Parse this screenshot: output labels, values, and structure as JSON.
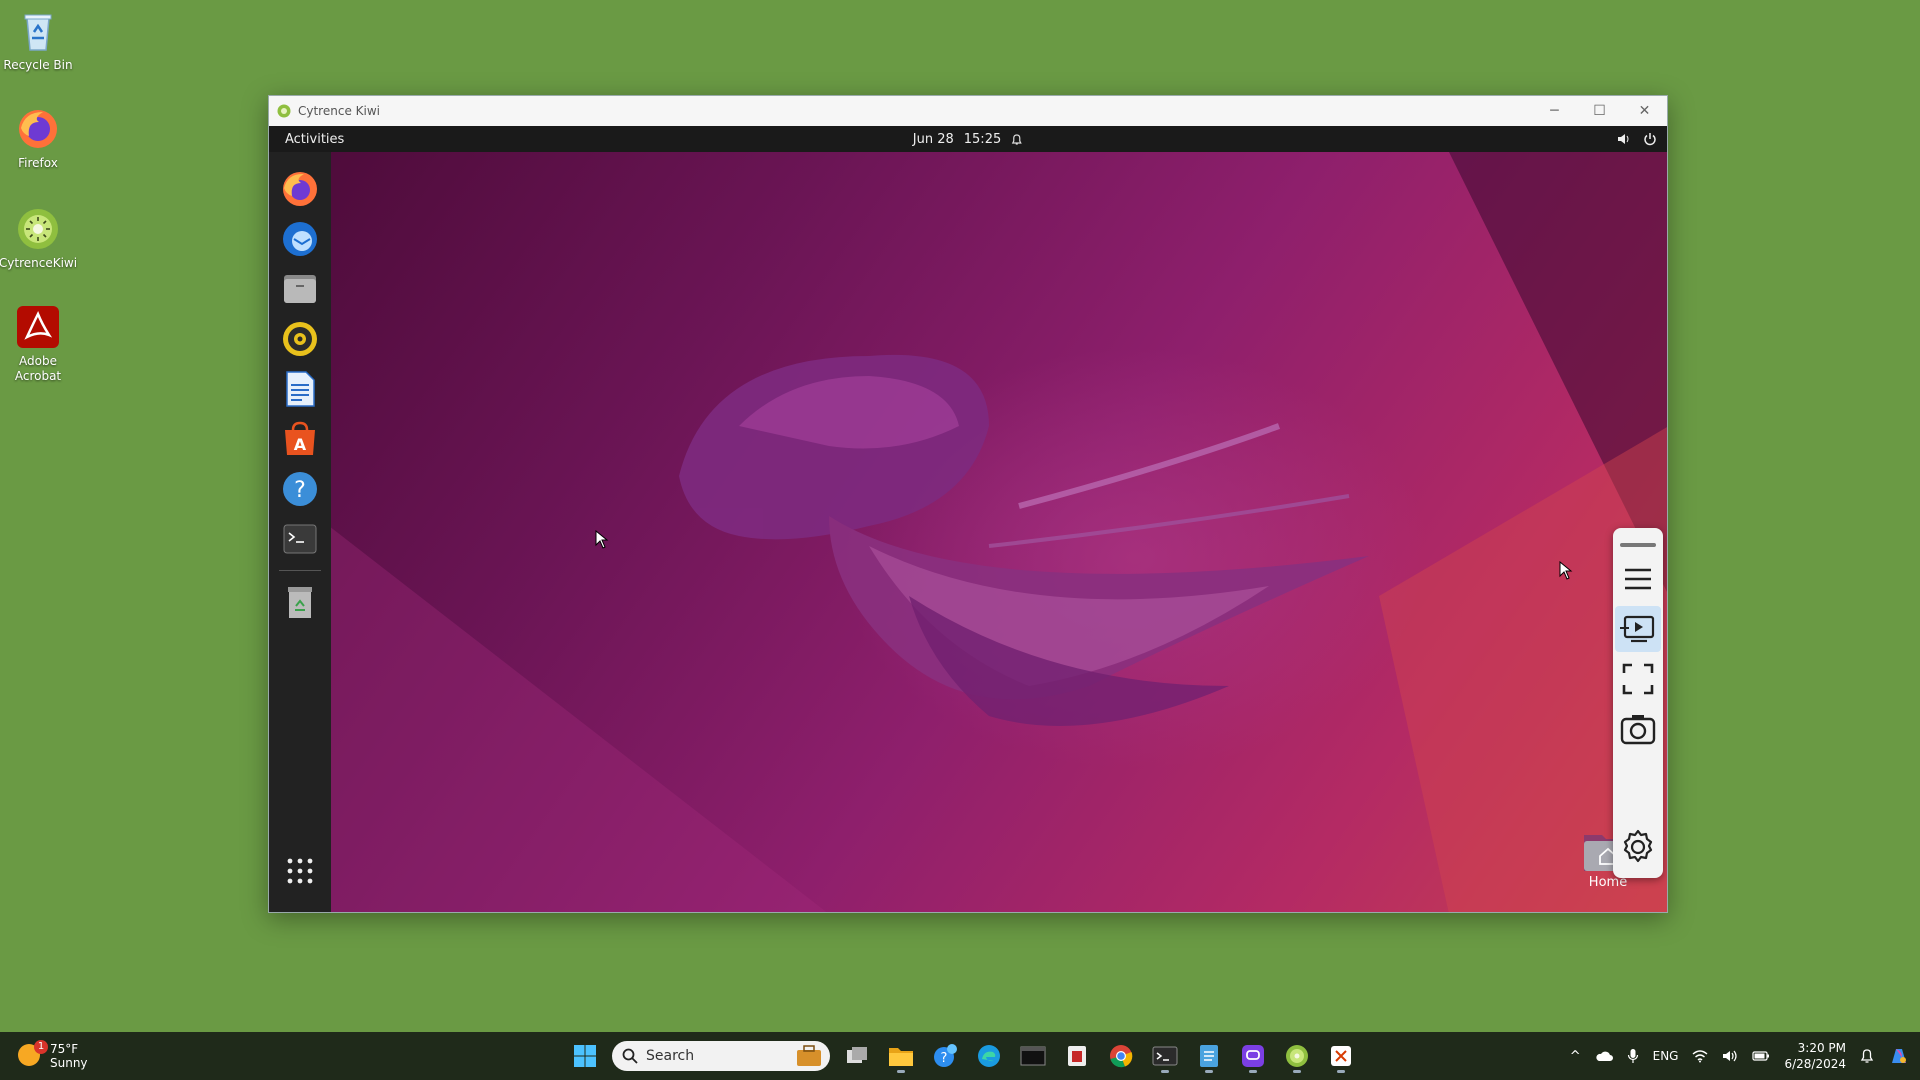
{
  "desktop": {
    "icons": [
      {
        "label": "Recycle Bin"
      },
      {
        "label": "Firefox"
      },
      {
        "label": "CytrenceKiwi"
      },
      {
        "label": "Adobe Acrobat"
      }
    ]
  },
  "window": {
    "title": "Cytrence Kiwi",
    "controls": {
      "minimize": "─",
      "maximize": "☐",
      "close": "✕"
    }
  },
  "guest": {
    "topbar": {
      "activities": "Activities",
      "date": "Jun 28",
      "time": "15:25"
    },
    "dock_apps": [
      "firefox-icon",
      "thunderbird-icon",
      "files-icon",
      "rhythmbox-icon",
      "writer-icon",
      "app-center-icon",
      "help-icon",
      "terminal-icon",
      "trash-icon"
    ],
    "home_folder_label": "Home"
  },
  "taskbar": {
    "weather": {
      "temp": "75°F",
      "condition": "Sunny",
      "badge": "1"
    },
    "search_placeholder": "Search",
    "tray": {
      "lang": "ENG",
      "time": "3:20 PM",
      "date": "6/28/2024"
    }
  },
  "colors": {
    "desktop_bg": "#6a9a44",
    "accent": "#0078d4"
  }
}
